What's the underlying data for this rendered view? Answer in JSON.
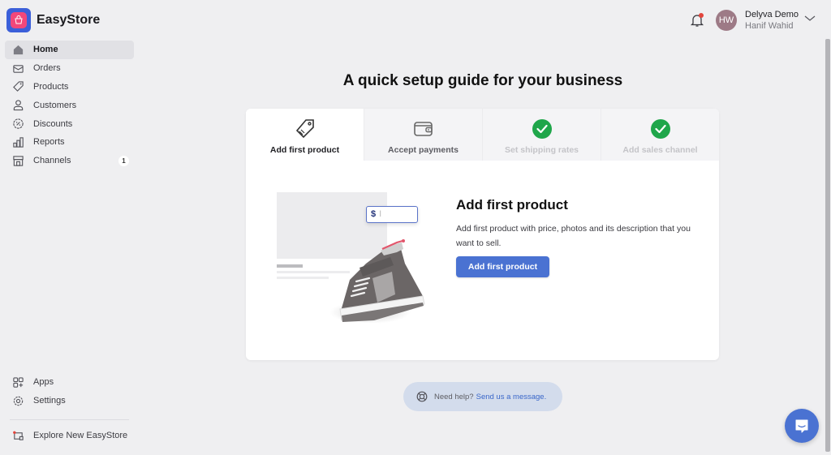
{
  "app": {
    "name": "EasyStore"
  },
  "sidebar": {
    "items": [
      {
        "label": "Home",
        "icon": "home-icon",
        "active": true
      },
      {
        "label": "Orders",
        "icon": "orders-icon"
      },
      {
        "label": "Products",
        "icon": "tag-icon"
      },
      {
        "label": "Customers",
        "icon": "user-icon"
      },
      {
        "label": "Discounts",
        "icon": "discount-icon"
      },
      {
        "label": "Reports",
        "icon": "bar-chart-icon"
      },
      {
        "label": "Channels",
        "icon": "store-icon",
        "badge": "1"
      }
    ],
    "bottom_items": [
      {
        "label": "Apps",
        "icon": "apps-icon"
      },
      {
        "label": "Settings",
        "icon": "gear-icon"
      }
    ],
    "explore": {
      "label": "Explore New EasyStore",
      "icon": "explore-icon"
    }
  },
  "header": {
    "user": {
      "initials": "HW",
      "store": "Delyva Demo",
      "name": "Hanif Wahid"
    }
  },
  "main": {
    "title": "A quick setup guide for your business",
    "tabs": [
      {
        "label": "Add first product",
        "icon": "tag-icon",
        "state": "active"
      },
      {
        "label": "Accept payments",
        "icon": "wallet-icon",
        "state": "pending"
      },
      {
        "label": "Set shipping rates",
        "icon": "check-circle-icon",
        "state": "done"
      },
      {
        "label": "Add sales channel",
        "icon": "check-circle-icon",
        "state": "done"
      }
    ],
    "content": {
      "title": "Add first product",
      "description": "Add first product with price, photos and its description that you want to sell.",
      "button": "Add first product",
      "illustration": {
        "price_symbol": "$",
        "cursor": "I"
      }
    },
    "help": {
      "prefix": "Need help?",
      "link": "Send us a message."
    }
  },
  "colors": {
    "primary": "#4a72d2",
    "success": "#1fa64a",
    "notification": "#e2453c"
  }
}
